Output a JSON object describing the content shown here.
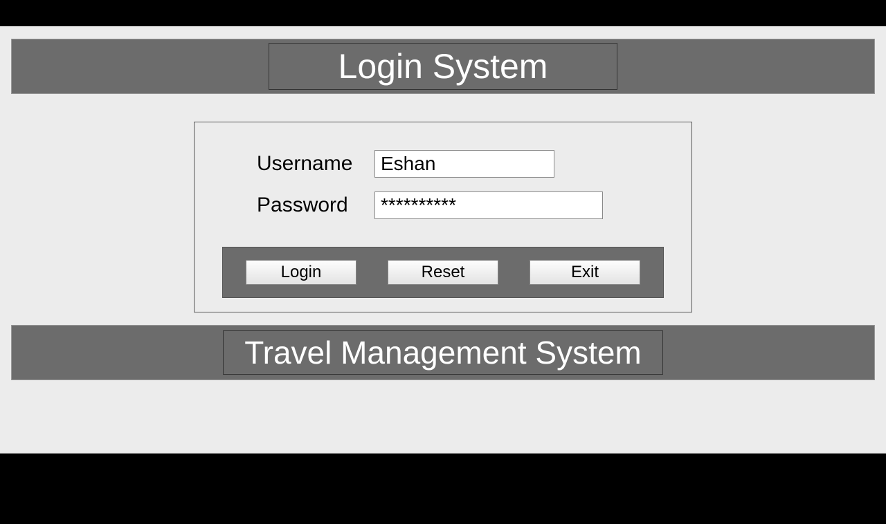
{
  "header": {
    "title": "Login System"
  },
  "form": {
    "username_label": "Username",
    "username_value": "Eshan",
    "password_label": "Password",
    "password_value": "**********"
  },
  "buttons": {
    "login_label": "Login",
    "reset_label": "Reset",
    "exit_label": "Exit"
  },
  "footer": {
    "title": "Travel Management System"
  }
}
